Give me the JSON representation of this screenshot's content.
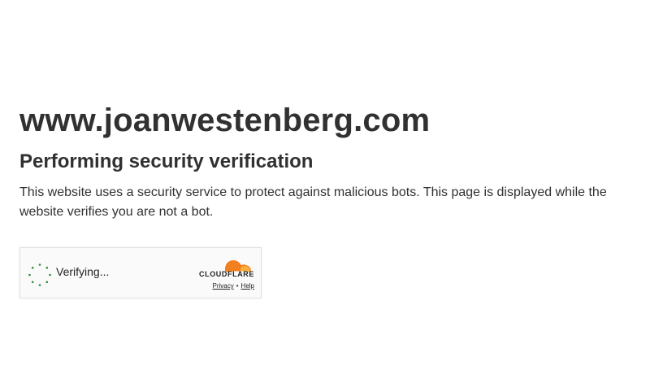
{
  "site": {
    "domain": "www.joanwestenberg.com"
  },
  "heading": {
    "title": "Performing security verification"
  },
  "body": {
    "description": "This website uses a security service to protect against malicious bots. This page is displayed while the website verifies you are not a bot."
  },
  "widget": {
    "status_text": "Verifying...",
    "brand": "CLOUDFLARE",
    "privacy_label": "Privacy",
    "separator": "•",
    "help_label": "Help",
    "colors": {
      "spinner": "#2f8a3c",
      "cloud_orange": "#f38020",
      "cloud_light": "#faae40"
    },
    "icons": [
      "spinner-icon",
      "cloudflare-logo-icon"
    ]
  }
}
